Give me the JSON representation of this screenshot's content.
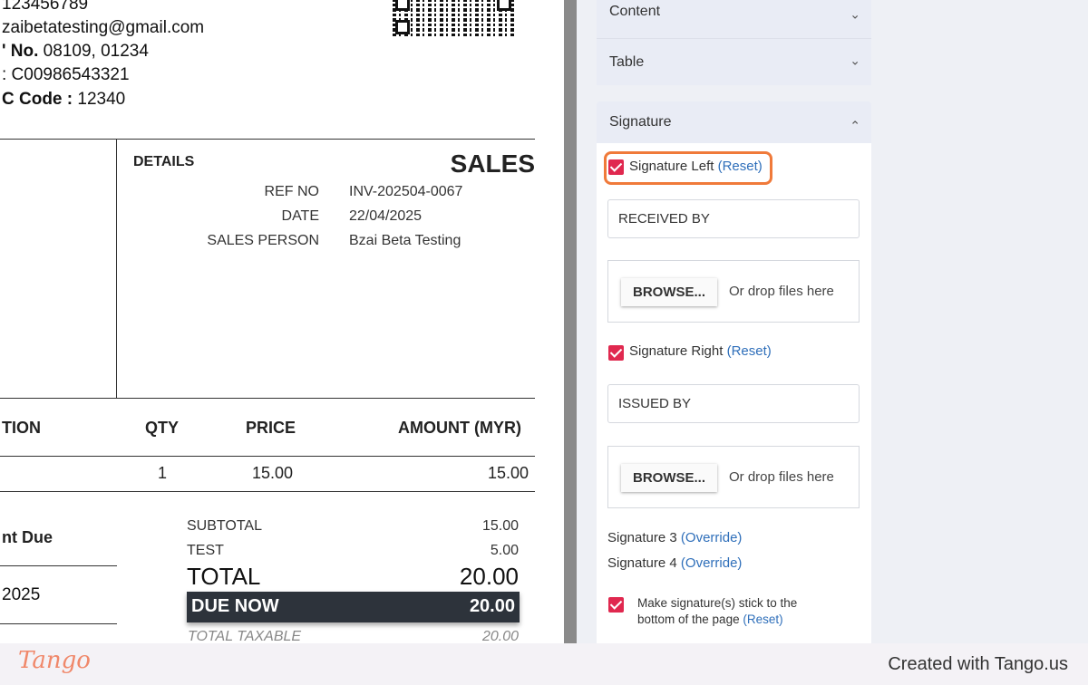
{
  "invoice": {
    "contact_lines": [
      {
        "label": "",
        "value": "123456789"
      },
      {
        "label": "",
        "value": "zaibetatesting@gmail.com"
      },
      {
        "label": "' No.",
        "value": " 08109, 01234"
      },
      {
        "label": "",
        "value": ": C00986543321"
      },
      {
        "label": "C Code :",
        "value": " 12340"
      }
    ],
    "details_title": "DETAILS",
    "doc_title": "SALES",
    "details": [
      {
        "label": "REF NO",
        "value": "INV-202504-0067"
      },
      {
        "label": "DATE",
        "value": "22/04/2025"
      },
      {
        "label": "SALES PERSON",
        "value": "Bzai Beta Testing"
      }
    ],
    "columns": {
      "description": "TION",
      "qty": "QTY",
      "price": "PRICE",
      "amount": "AMOUNT (MYR)"
    },
    "row": {
      "qty": "1",
      "price": "15.00",
      "amount": "15.00"
    },
    "amount_due_label": "nt Due",
    "amount_due_date": "2025",
    "totals": [
      {
        "label": "SUBTOTAL",
        "value": "15.00"
      },
      {
        "label": "TEST",
        "value": "5.00"
      }
    ],
    "total": {
      "label": "TOTAL",
      "value": "20.00"
    },
    "due_now": {
      "label": "DUE NOW",
      "value": "20.00"
    },
    "total_taxable": {
      "label": "TOTAL TAXABLE",
      "value": "20.00"
    }
  },
  "panel": {
    "sections": {
      "content": "Content",
      "table": "Table",
      "signature": "Signature"
    },
    "signature_left": {
      "label": "Signature Left",
      "reset": "(Reset)",
      "value": "RECEIVED BY"
    },
    "signature_right": {
      "label": "Signature Right",
      "reset": "(Reset)",
      "value": "ISSUED BY"
    },
    "browse_label": "BROWSE...",
    "drop_text": "Or drop files here",
    "signature_3": {
      "label": "Signature 3",
      "override": "(Override)"
    },
    "signature_4": {
      "label": "Signature 4",
      "override": "(Override)"
    },
    "stick_bottom": {
      "label": "Make signature(s) stick to the bottom of the page",
      "reset": "(Reset)"
    },
    "chevron_down": "⌄",
    "chevron_up": "⌃"
  },
  "footer": {
    "logo": "Tango",
    "credit": "Created with Tango.us"
  },
  "colors": {
    "accent_checkbox": "#e0284f",
    "highlight": "#f07a3a",
    "link": "#2f6fba",
    "due_bar": "#2d333b"
  }
}
